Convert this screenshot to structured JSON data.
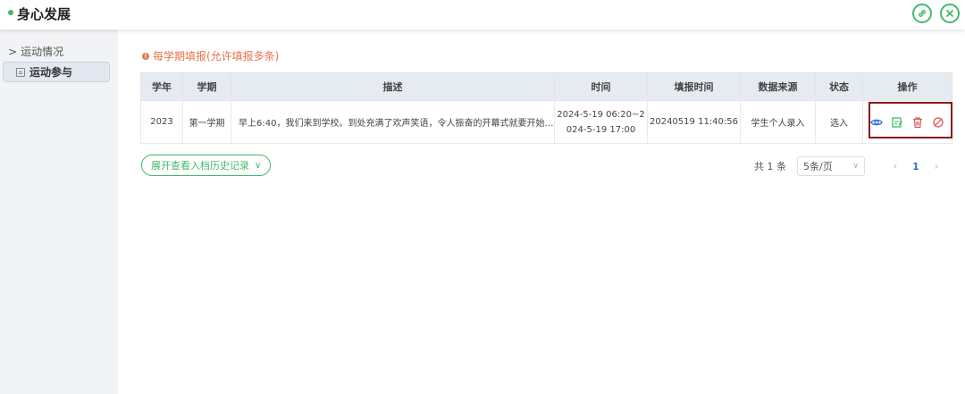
{
  "header": {
    "title": "身心发展",
    "accent": "#43b96a"
  },
  "sidebar": {
    "group_label": "运动情况",
    "items": [
      {
        "label": "运动参与"
      }
    ]
  },
  "main": {
    "notice": "每学期填报(允许填报多条)",
    "table": {
      "columns": [
        "学年",
        "学期",
        "描述",
        "时间",
        "填报时间",
        "数据来源",
        "状态",
        "操作"
      ],
      "rows": [
        {
          "year": "2023",
          "term": "第一学期",
          "description": "早上6:40，我们来到学校。到处充满了欢声笑语，令人振奋的开幕式就要开始了！...",
          "time_line1": "2024-5-19 06:20~2",
          "time_line2": "024-5-19 17:00",
          "filled_time": "20240519 11:40:56",
          "source": "学生个人录入",
          "status": "选入"
        }
      ]
    },
    "expand_button": "展开查看入档历史记录",
    "pager": {
      "total": "共 1 条",
      "page_size": "5条/页",
      "current_page": "1"
    }
  }
}
